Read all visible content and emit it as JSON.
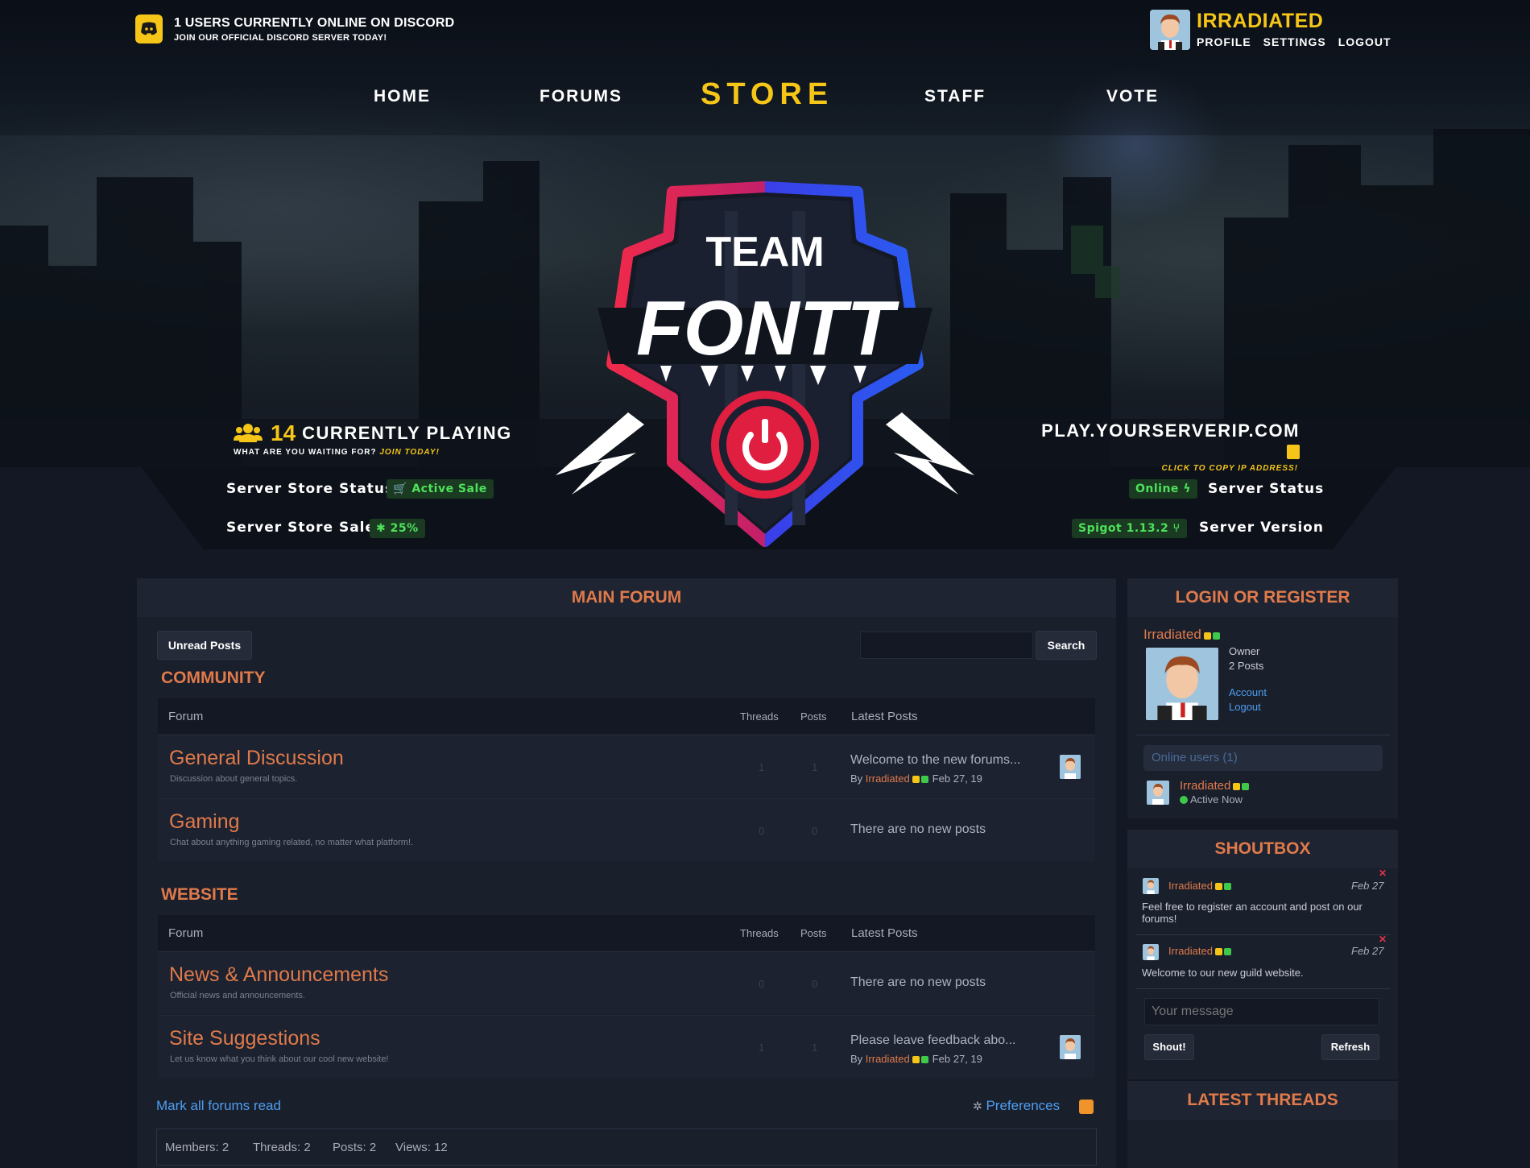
{
  "discord": {
    "line1": "1 USERS CURRENTLY ONLINE ON DISCORD",
    "line2": "JOIN OUR OFFICIAL DISCORD SERVER TODAY!"
  },
  "user": {
    "name": "IRRADIATED",
    "links": [
      "PROFILE",
      "SETTINGS",
      "LOGOUT"
    ]
  },
  "nav": {
    "home": "HOME",
    "forums": "FORUMS",
    "store": "STORE",
    "staff": "STAFF",
    "vote": "VOTE",
    "active": "store"
  },
  "logo": {
    "line1": "TEAM",
    "line2": "FONTT"
  },
  "hero": {
    "playing_count": "14",
    "playing_label": "CURRENTLY PLAYING",
    "playing_sub": "WHAT ARE YOU WAITING FOR?",
    "playing_sub_cta": "JOIN TODAY!",
    "ip": "PLAY.YOURSERVERIP.COM",
    "ip_sub": "CLICK TO COPY IP ADDRESS!"
  },
  "status": {
    "store_status_label": "Server Store Status",
    "store_status_value": "Active Sale",
    "store_sale_label": "Server Store Sale",
    "store_sale_value": "25%",
    "server_status_label": "Server Status",
    "server_status_value": "Online",
    "server_version_label": "Server Version",
    "server_version_value": "Spigot 1.13.2"
  },
  "main_forum": {
    "title": "MAIN FORUM",
    "unread_button": "Unread Posts",
    "search_button": "Search",
    "columns": {
      "forum": "Forum",
      "threads": "Threads",
      "posts": "Posts",
      "latest": "Latest Posts"
    },
    "sections": [
      {
        "title": "COMMUNITY",
        "forums": [
          {
            "title": "General Discussion",
            "desc": "Discussion about general topics.",
            "threads": "1",
            "posts": "1",
            "latest": "Welcome to the new forums...",
            "by": "By",
            "by_user": "Irradiated",
            "date": "Feb 27, 19"
          },
          {
            "title": "Gaming",
            "desc": "Chat about anything gaming related, no matter what platform!.",
            "threads": "0",
            "posts": "0",
            "latest": "There are no new posts"
          }
        ]
      },
      {
        "title": "WEBSITE",
        "forums": [
          {
            "title": "News & Announcements",
            "desc": "Official news and announcements.",
            "threads": "0",
            "posts": "0",
            "latest": "There are no new posts"
          },
          {
            "title": "Site Suggestions",
            "desc": "Let us know what you think about our cool new website!",
            "threads": "1",
            "posts": "1",
            "latest": "Please leave feedback abo...",
            "by": "By",
            "by_user": "Irradiated",
            "date": "Feb 27, 19"
          }
        ]
      }
    ],
    "mark_read": "Mark all forums read",
    "preferences": "Preferences",
    "stats": {
      "members": "Members: 2",
      "threads": "Threads: 2",
      "posts": "Posts: 2",
      "views": "Views: 12"
    }
  },
  "login": {
    "title": "LOGIN OR REGISTER",
    "name": "Irradiated",
    "role": "Owner",
    "posts": "2 Posts",
    "account": "Account",
    "logout": "Logout",
    "online_users": "Online users (1)",
    "online_name": "Irradiated",
    "online_status": "Active Now"
  },
  "shoutbox": {
    "title": "SHOUTBOX",
    "messages": [
      {
        "user": "Irradiated",
        "date": "Feb 27",
        "text": "Feel free to register an account and post on our forums!"
      },
      {
        "user": "Irradiated",
        "date": "Feb 27",
        "text": "Welcome to our new guild website."
      }
    ],
    "placeholder": "Your message",
    "shout_button": "Shout!",
    "refresh_button": "Refresh"
  },
  "latest_threads": {
    "title": "LATEST THREADS"
  },
  "colors": {
    "accent": "#e07a4a",
    "gold": "#f5c518",
    "link": "#4d9ef0",
    "online": "#3ec94a"
  }
}
